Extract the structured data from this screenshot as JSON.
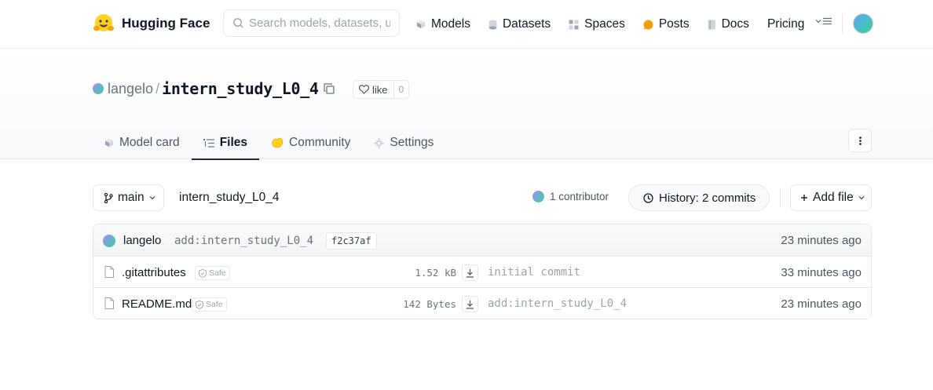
{
  "nav": {
    "brand": "Hugging Face",
    "search_placeholder": "Search models, datasets, users...",
    "items": [
      {
        "label": "Models",
        "icon": "cube-icon"
      },
      {
        "label": "Datasets",
        "icon": "database-icon"
      },
      {
        "label": "Spaces",
        "icon": "grid-icon"
      },
      {
        "label": "Posts",
        "icon": "chat-bubble-icon"
      },
      {
        "label": "Docs",
        "icon": "book-icon"
      },
      {
        "label": "Pricing",
        "icon": ""
      }
    ]
  },
  "repo": {
    "owner": "langelo",
    "name": "intern_study_L0_4",
    "like_label": "like",
    "like_count": "0"
  },
  "tabs": [
    {
      "label": "Model card",
      "active": false
    },
    {
      "label": "Files",
      "active": true
    },
    {
      "label": "Community",
      "active": false
    },
    {
      "label": "Settings",
      "active": false
    }
  ],
  "toolbar": {
    "branch": "main",
    "path": "intern_study_L0_4",
    "contributors": "1 contributor",
    "history": "History: 2 commits",
    "add_file": "Add file"
  },
  "last_commit": {
    "user": "langelo",
    "message": "add:intern_study_L0_4",
    "hash": "f2c37af",
    "time": "23 minutes ago"
  },
  "files": [
    {
      "name": ".gitattributes",
      "safe": "Safe",
      "size": "1.52 kB",
      "message": "initial commit",
      "time": "33 minutes ago"
    },
    {
      "name": "README.md",
      "safe": "Safe",
      "size": "142 Bytes",
      "message": "add:intern_study_L0_4",
      "time": "23 minutes ago"
    }
  ],
  "colors": {
    "accent_dark": "#1f2937",
    "border": "#e5e7eb",
    "muted": "#6b7280"
  }
}
